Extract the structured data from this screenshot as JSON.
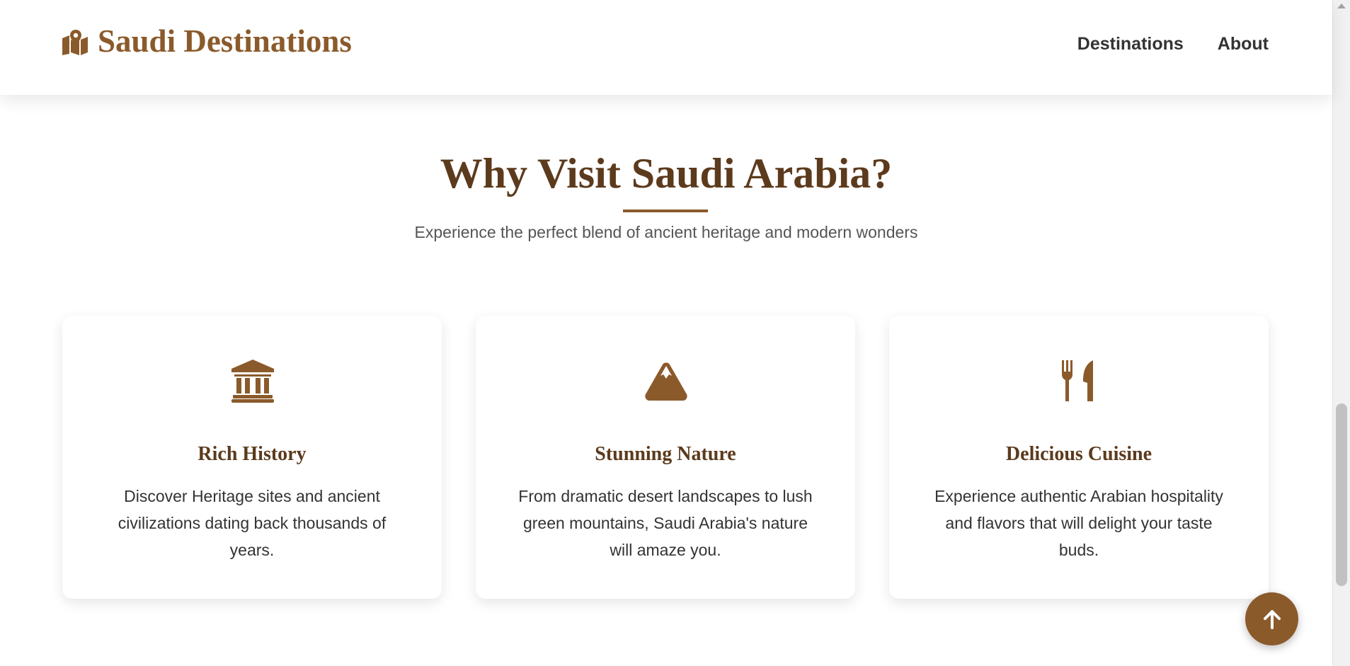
{
  "header": {
    "brand_icon": "map-location-icon",
    "brand_text": "Saudi Destinations",
    "nav": [
      {
        "label": "Destinations"
      },
      {
        "label": "About"
      }
    ]
  },
  "section": {
    "title": "Why Visit Saudi Arabia?",
    "subtitle": "Experience the perfect blend of ancient heritage and modern wonders"
  },
  "cards": [
    {
      "icon": "landmark-icon",
      "title": "Rich History",
      "text": "Discover Heritage sites and ancient civilizations dating back thousands of years."
    },
    {
      "icon": "mountain-icon",
      "title": "Stunning Nature",
      "text": "From dramatic desert landscapes to lush green mountains, Saudi Arabia's nature will amaze you."
    },
    {
      "icon": "utensils-icon",
      "title": "Delicious Cuisine",
      "text": "Experience authentic Arabian hospitality and flavors that will delight your taste buds."
    }
  ],
  "back_to_top": {
    "icon": "arrow-up-icon"
  },
  "colors": {
    "accent": "#8b5a2b",
    "heading": "#5c3a1c",
    "text": "#333333",
    "subtitle": "#555555"
  }
}
